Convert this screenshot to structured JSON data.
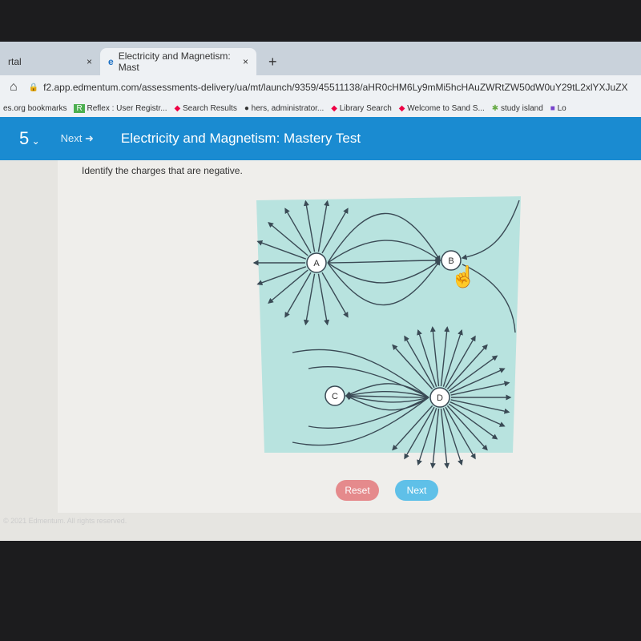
{
  "browser": {
    "tabs": [
      {
        "label": "rtal"
      },
      {
        "label": "Electricity and Magnetism: Mast",
        "active": true
      }
    ],
    "new_tab": "+",
    "close": "×",
    "url": "f2.app.edmentum.com/assessments-delivery/ua/mt/launch/9359/45511138/aHR0cHM6Ly9mMi5hcHAuZWRtZW50dW0uY29tL2xlYXJuZX",
    "bookmarks": [
      "es.org bookmarks",
      "Reflex : User Registr...",
      "Search Results",
      "hers, administrator...",
      "Library Search",
      "Welcome to Sand S...",
      "study island",
      "Lo"
    ]
  },
  "header": {
    "question_number": "5",
    "next_label": "Next",
    "title": "Electricity and Magnetism: Mastery Test",
    "accent": "#1a8bd1"
  },
  "question": {
    "prompt": "Identify the charges that are negative."
  },
  "diagram": {
    "background": "#b8e3df",
    "charges": [
      {
        "label": "A"
      },
      {
        "label": "B"
      },
      {
        "label": "C"
      },
      {
        "label": "D"
      }
    ]
  },
  "actions": {
    "reset": "Reset",
    "next": "Next",
    "reset_color": "#e58a8c",
    "next_color": "#5fc0e8"
  },
  "footer": {
    "copyright": "© 2021 Edmentum. All rights reserved."
  }
}
